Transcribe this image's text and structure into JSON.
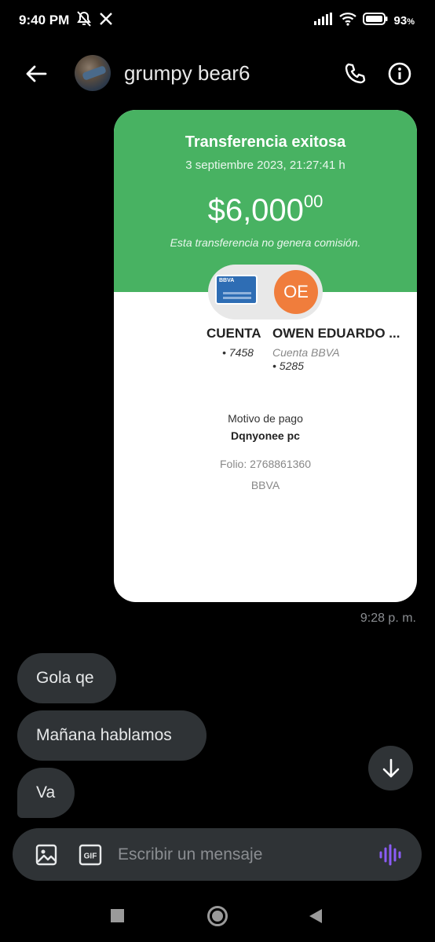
{
  "status_bar": {
    "time": "9:40 PM",
    "battery": "93",
    "battery_unit": "%",
    "icons": [
      "muted-bell-icon",
      "x-logo-icon",
      "signal-icon",
      "wifi-icon",
      "battery-icon"
    ]
  },
  "header": {
    "contact_name": "grumpy bear6",
    "icons": [
      "back-arrow-icon",
      "phone-icon",
      "info-icon"
    ]
  },
  "receipt": {
    "title": "Transferencia exitosa",
    "date": "3 septiembre 2023, 21:27:41 h",
    "amount_main": "$6,000",
    "amount_cents": "00",
    "note": "Esta transferencia no genera comisión.",
    "sender_label": "CUENTA",
    "sender_number": "• 7458",
    "card_brand": "BBVA",
    "recipient_initials": "OE",
    "recipient_label": "OWEN EDUARDO ...",
    "recipient_bank": "Cuenta BBVA",
    "recipient_number": "• 5285",
    "motivo_label": "Motivo de pago",
    "motivo_value": "Dqnyonee pc",
    "folio": "Folio: 2768861360",
    "bank": "BBVA",
    "colors": {
      "header_green": "#48b262",
      "initials_orange": "#f07d3c"
    }
  },
  "sent_time": "9:28 p. m.",
  "messages": [
    {
      "text": "Gola qe"
    },
    {
      "text": "Mañana hablamos"
    },
    {
      "text": "Va"
    }
  ],
  "composer": {
    "placeholder": "Escribir un mensaje",
    "gif_label": "GIF",
    "voice_color": "#8b5cf6"
  }
}
